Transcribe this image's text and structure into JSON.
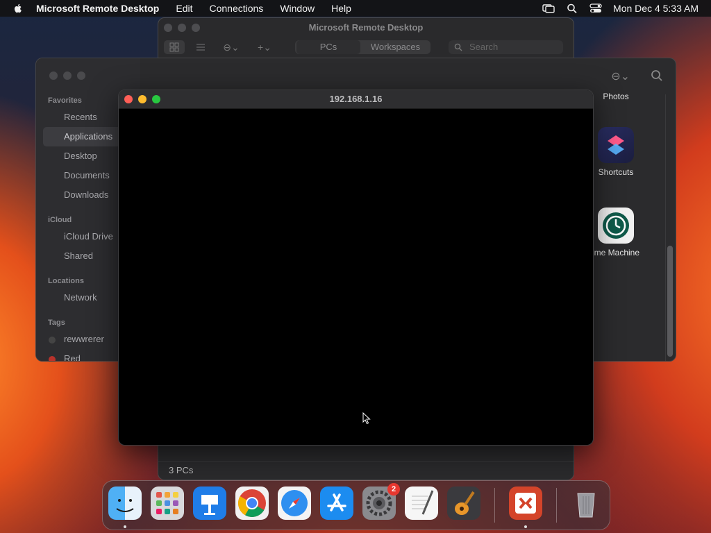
{
  "menubar": {
    "app_name": "Microsoft Remote Desktop",
    "items": [
      "Edit",
      "Connections",
      "Window",
      "Help"
    ],
    "datetime": "Mon Dec 4  5:33 AM"
  },
  "rd_window": {
    "title": "Microsoft Remote Desktop",
    "tabs": [
      "PCs",
      "Workspaces"
    ],
    "search_placeholder": "Search",
    "footer": "3 PCs"
  },
  "finder": {
    "sections": {
      "favorites": "Favorites",
      "icloud": "iCloud",
      "locations": "Locations",
      "tags": "Tags"
    },
    "favorites": [
      "Recents",
      "Applications",
      "Desktop",
      "Documents",
      "Downloads"
    ],
    "icloud": [
      "iCloud Drive",
      "Shared"
    ],
    "locations": [
      "Network"
    ],
    "tags": [
      "rewwrerer",
      "Red"
    ],
    "apps": [
      "Photos",
      "Shortcuts",
      "ime Machine"
    ]
  },
  "session": {
    "title": "192.168.1.16"
  },
  "dock": {
    "settings_badge": "2"
  },
  "colors": {
    "close": "#ff5f57",
    "minimize": "#febc2e",
    "zoom": "#28c840"
  }
}
